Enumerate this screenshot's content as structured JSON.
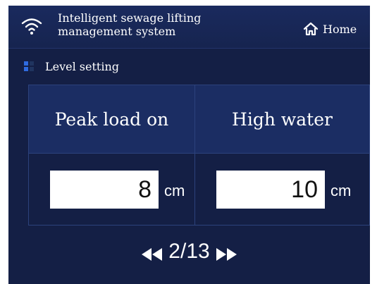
{
  "header": {
    "title_line1": "Intelligent sewage lifting",
    "title_line2": "management system",
    "home_label": "Home",
    "wifi_icon": "wifi-icon",
    "home_icon": "home-icon"
  },
  "section": {
    "title": "Level setting",
    "icon": "grid-squares-icon"
  },
  "params": [
    {
      "label": "Peak load on",
      "value": "8",
      "unit": "cm"
    },
    {
      "label": "High water",
      "value": "10",
      "unit": "cm"
    }
  ],
  "pager": {
    "current_text": "2/13",
    "prev_icon": "double-left-arrow-icon",
    "next_icon": "double-right-arrow-icon"
  },
  "colors": {
    "background": "#141f45",
    "header": "#1a2a5e",
    "table_header": "#1b2d63",
    "grid_line": "#2c427c",
    "accent_blue": "#2f6be0"
  }
}
